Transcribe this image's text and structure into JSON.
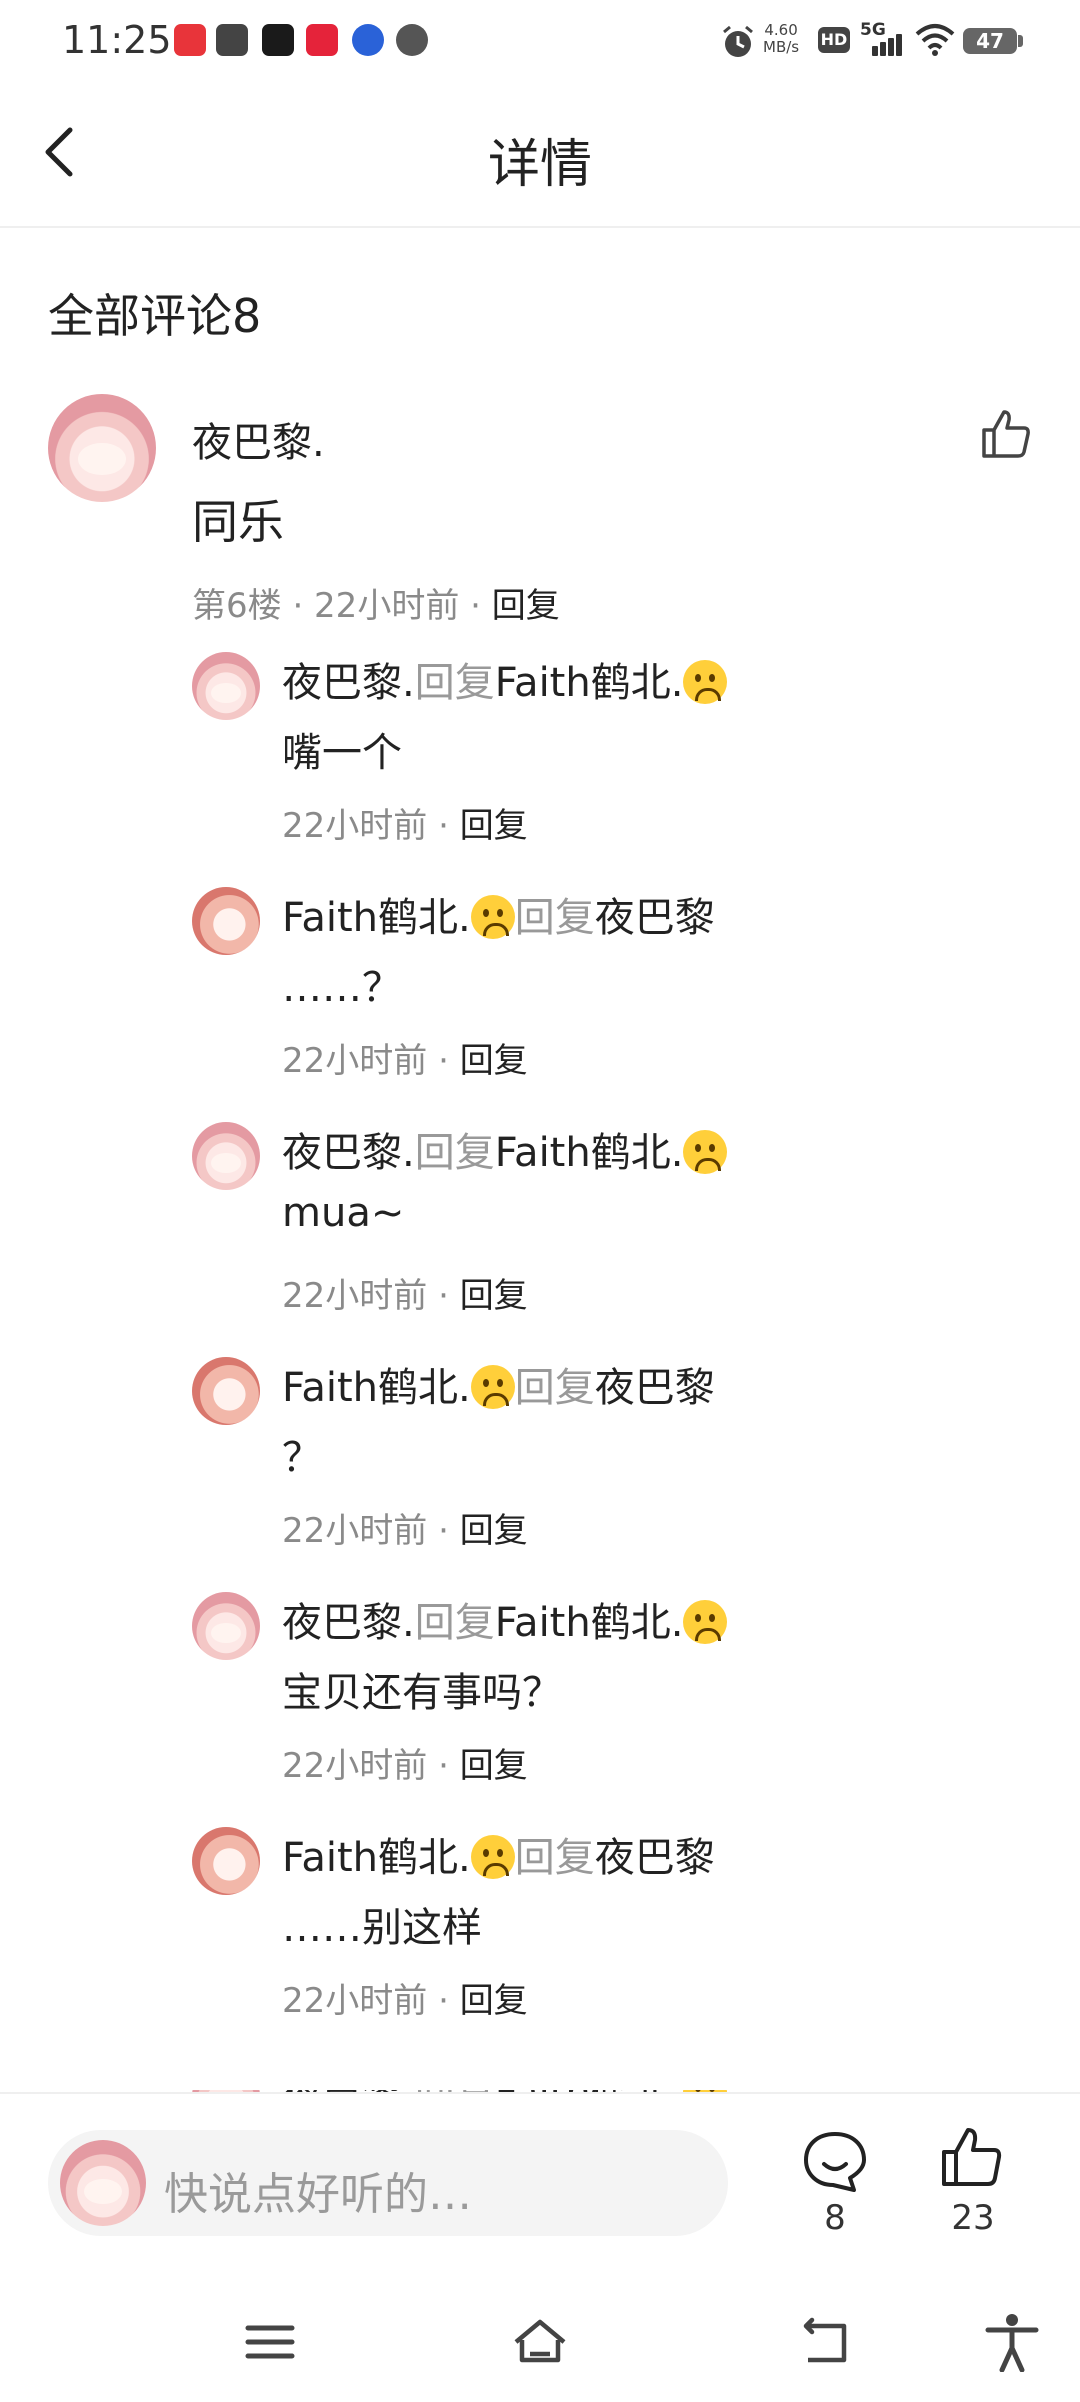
{
  "status_bar": {
    "time": "11:25",
    "net_speed_value": "4.60",
    "net_speed_unit": "MB/s",
    "hd": "HD",
    "signal": "5G",
    "battery": "47"
  },
  "header": {
    "title": "详情"
  },
  "comments": {
    "title": "全部评论8",
    "main": {
      "name": "夜巴黎.",
      "text": "同乐",
      "meta": "第6楼 · 22小时前 · ",
      "reply_label": "回复"
    },
    "replies": [
      {
        "from": "夜巴黎.",
        "reply_word": "回复",
        "to": "Faith鹤北.",
        "text": "嘴一个",
        "time": "22小时前 · ",
        "reply_label": "回复",
        "avatar": "pink"
      },
      {
        "from": "Faith鹤北.",
        "reply_word": "回复",
        "to": "夜巴黎",
        "text": "……？",
        "time": "22小时前 · ",
        "reply_label": "回复",
        "avatar": "red"
      },
      {
        "from": "夜巴黎.",
        "reply_word": "回复",
        "to": "Faith鹤北.",
        "text": "mua~",
        "time": "22小时前 · ",
        "reply_label": "回复",
        "avatar": "pink"
      },
      {
        "from": "Faith鹤北.",
        "reply_word": "回复",
        "to": "夜巴黎",
        "text": "？",
        "time": "22小时前 · ",
        "reply_label": "回复",
        "avatar": "red"
      },
      {
        "from": "夜巴黎.",
        "reply_word": "回复",
        "to": "Faith鹤北.",
        "text": "宝贝还有事吗？",
        "time": "22小时前 · ",
        "reply_label": "回复",
        "avatar": "pink"
      },
      {
        "from": "Faith鹤北.",
        "reply_word": "回复",
        "to": "夜巴黎",
        "text": "……别这样",
        "time": "22小时前 · ",
        "reply_label": "回复",
        "avatar": "red"
      },
      {
        "from": "夜巴黎.",
        "reply_word": "回复",
        "to": "Faith鹤北.",
        "text": "",
        "time": "",
        "reply_label": "",
        "avatar": "pink"
      }
    ]
  },
  "bottom_bar": {
    "input_placeholder": "快说点好听的…",
    "comment_count": "8",
    "like_count": "23"
  }
}
